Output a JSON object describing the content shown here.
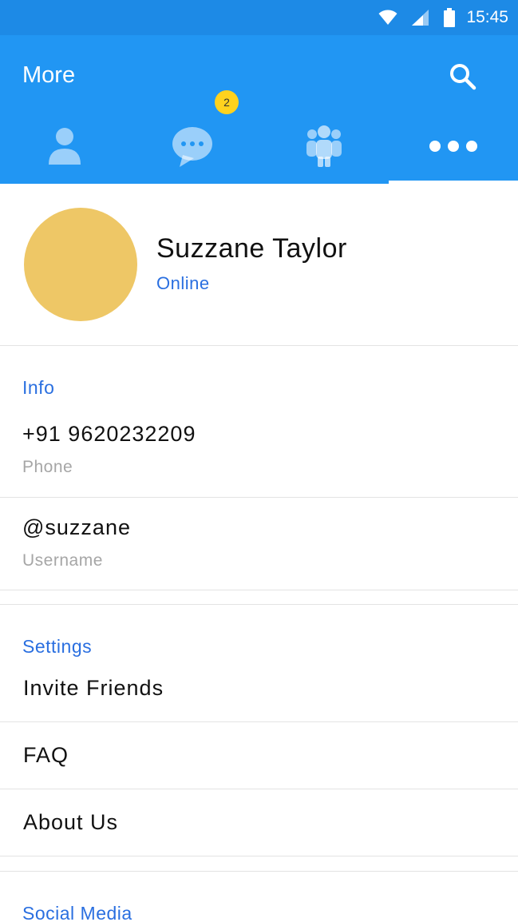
{
  "status_bar": {
    "time": "15:45",
    "icons": [
      "wifi-icon",
      "cell-signal-icon",
      "battery-icon"
    ]
  },
  "app_bar": {
    "title": "More",
    "search_icon": "search-icon",
    "color": "#2196f3"
  },
  "tabs": [
    {
      "name": "contacts",
      "icon": "person-icon",
      "active": false
    },
    {
      "name": "chats",
      "icon": "chat-bubble-icon",
      "badge": "2",
      "active": false
    },
    {
      "name": "groups",
      "icon": "group-icon",
      "active": false
    },
    {
      "name": "more",
      "icon": "more-dots-icon",
      "active": true
    }
  ],
  "profile": {
    "name": "Suzzane Taylor",
    "status": "Online",
    "avatar_color": "#eec766"
  },
  "info": {
    "title": "Info",
    "phone": {
      "value": "+91 9620232209",
      "label": "Phone"
    },
    "username": {
      "value": "@suzzane",
      "label": "Username"
    }
  },
  "settings": {
    "title": "Settings",
    "items": [
      "Invite Friends",
      "FAQ",
      "About Us"
    ]
  },
  "social": {
    "title": "Social Media"
  },
  "colors": {
    "accent": "#2a6fe0",
    "badge": "#ffd21e"
  }
}
